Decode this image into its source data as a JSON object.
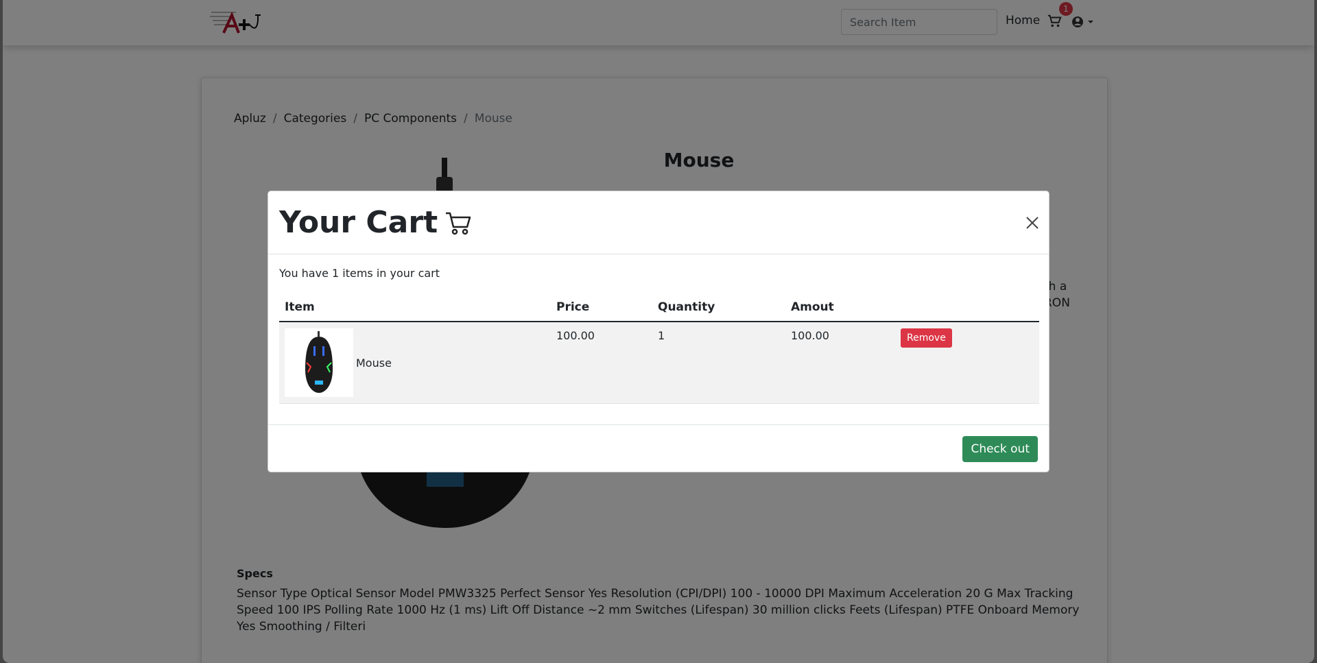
{
  "navbar": {
    "search_placeholder": "Search Item",
    "home_label": "Home",
    "cart_badge": "1"
  },
  "breadcrumb": {
    "items": [
      "Apluz",
      "Categories",
      "PC Components",
      "Mouse"
    ],
    "separator": "/"
  },
  "product": {
    "title": "Mouse",
    "description_fragment_1": "th a",
    "description_fragment_2": "RON",
    "specs_title": "Specs",
    "specs_text": "Sensor Type Optical Sensor Model PMW3325 Perfect Sensor Yes Resolution (CPI/DPI) 100 - 10000 DPI Maximum Acceleration 20 G Max Tracking Speed 100 IPS Polling Rate 1000 Hz (1 ms) Lift Off Distance ~2 mm Switches (Lifespan) 30 million clicks Feets (Lifespan) PTFE Onboard Memory Yes Smoothing / Filteri"
  },
  "modal": {
    "title": "Your Cart",
    "count_text": "You have 1 items in your cart",
    "columns": [
      "Item",
      "Price",
      "Quantity",
      "Amout"
    ],
    "rows": [
      {
        "name": "Mouse",
        "price": "100.00",
        "quantity": "1",
        "amount": "100.00",
        "remove_label": "Remove"
      }
    ],
    "checkout_label": "Check out"
  },
  "colors": {
    "danger": "#dc3545",
    "success": "#2e8b57",
    "overlay": "rgba(0,0,0,0.5)"
  },
  "icons": [
    "logo",
    "cart-icon",
    "user-icon",
    "chevron-down-icon",
    "shopping-cart-icon",
    "close-icon"
  ]
}
